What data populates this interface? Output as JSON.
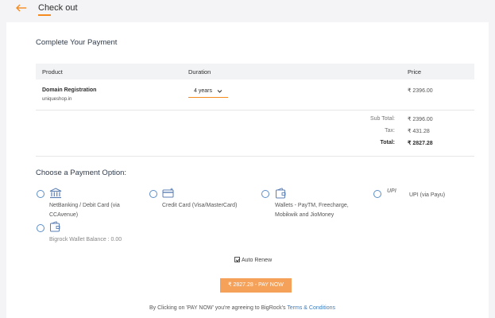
{
  "header": {
    "title": "Check out",
    "back_icon": "back-arrow-icon",
    "accent": "#f58a1f"
  },
  "payment": {
    "title": "Complete Your Payment"
  },
  "table": {
    "headers": {
      "product": "Product",
      "duration": "Duration",
      "price": "Price"
    },
    "row": {
      "product": "Domain Registration",
      "domain": "uniqueshop.in",
      "duration": "4 years",
      "price": "₹ 2396.00"
    }
  },
  "summary": {
    "subtotal_label": "Sub Total:",
    "subtotal": "₹ 2396.00",
    "tax_label": "Tax:",
    "tax": "₹ 431.28",
    "total_label": "Total:",
    "total": "₹ 2827.28"
  },
  "options": {
    "title": "Choose a Payment Option:",
    "items": [
      {
        "label_1": "NetBanking / Debit Card (via",
        "label_2": "CCAvenue)",
        "icon": "bank-icon"
      },
      {
        "label_1": "Credit Card (Visa/MasterCard)",
        "icon": "credit-card-icon"
      },
      {
        "label_1": "Wallets - PayTM, Freecharge,",
        "label_2": "Mobikwik and JioMoney",
        "icon": "wallet-icon"
      },
      {
        "label_1": "UPI (via Payu)",
        "icon_text": "UPI",
        "icon": "upi-icon"
      },
      {
        "label_1": "Bigrock Wallet Balance : 0.00",
        "icon": "wallet-icon"
      }
    ]
  },
  "auto_renew": {
    "label": "Auto Renew",
    "checked": true
  },
  "pay_button": {
    "label": "₹ 2827.28 - PAY NOW",
    "color": "#f5a15a"
  },
  "terms": {
    "prefix": "By Clicking on 'PAY NOW' you're agreeing to BigRock's ",
    "link": "Terms & Conditions",
    "link_color": "#3a7fc1"
  }
}
